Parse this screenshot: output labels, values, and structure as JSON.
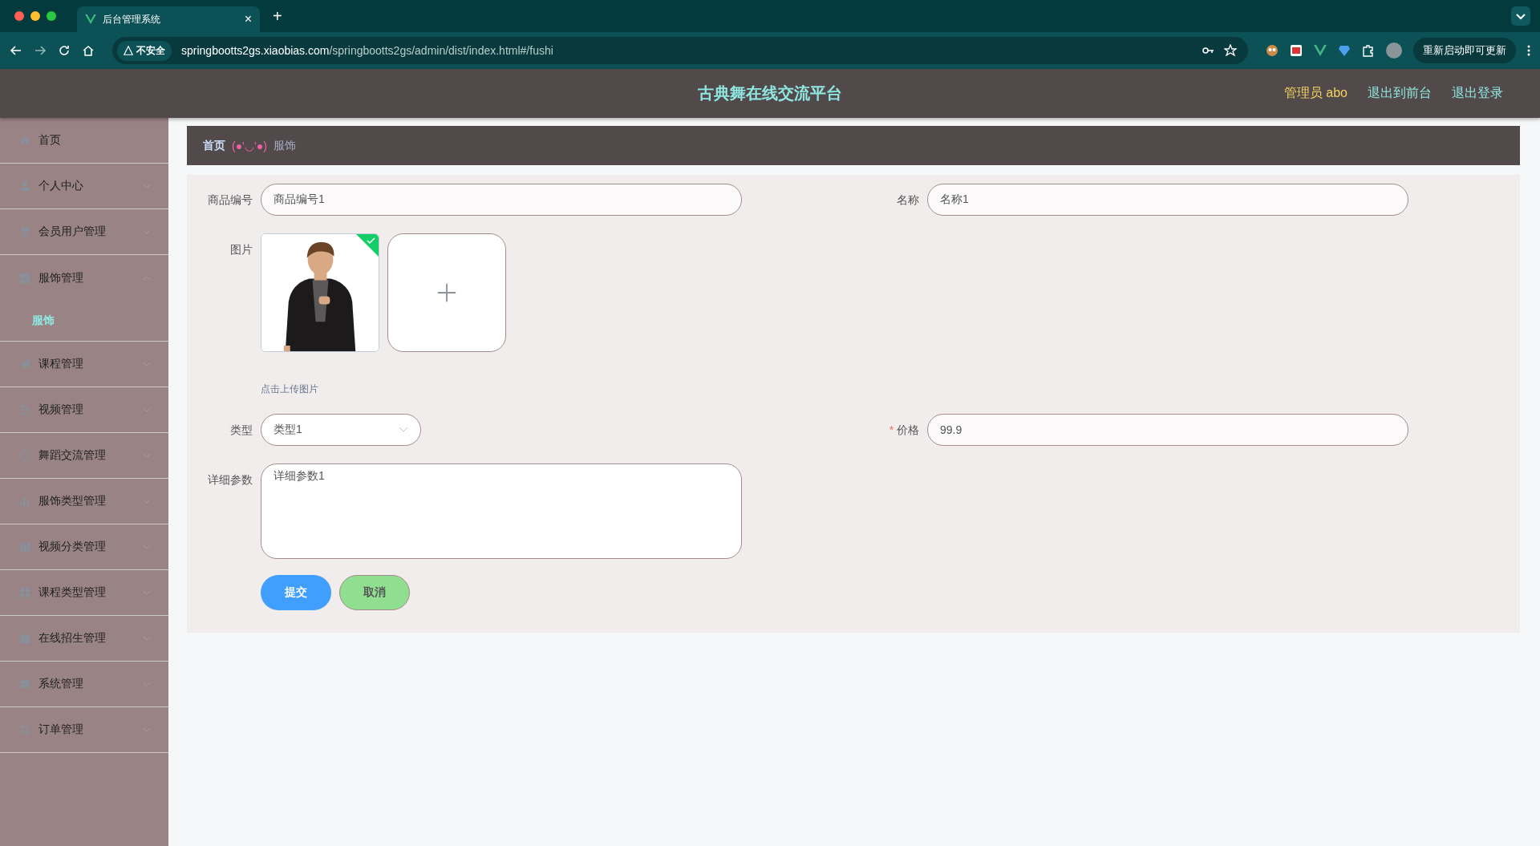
{
  "browser": {
    "tab_title": "后台管理系统",
    "tab_close": "×",
    "new_tab": "+",
    "security": "不安全",
    "url_host": "springbootts2gs.xiaobias.com",
    "url_path": "/springbootts2gs/admin/dist/index.html#/fushi",
    "update_button": "重新启动即可更新"
  },
  "header": {
    "title": "古典舞在线交流平台",
    "user": "管理员 abo",
    "links": [
      "退出到前台",
      "退出登录"
    ]
  },
  "sidebar": {
    "items": [
      {
        "kind": "link",
        "label": "首页",
        "selected": false
      },
      {
        "kind": "submenu",
        "label": "个人中心",
        "selected": false,
        "expanded": false
      },
      {
        "kind": "submenu",
        "label": "会员用户管理",
        "selected": false,
        "expanded": false
      },
      {
        "kind": "submenu",
        "label": "服饰管理",
        "selected": false,
        "expanded": true,
        "children": [
          {
            "label": "服饰",
            "selected": true
          }
        ]
      },
      {
        "kind": "submenu",
        "label": "课程管理",
        "selected": false,
        "expanded": false
      },
      {
        "kind": "submenu",
        "label": "视频管理",
        "selected": false,
        "expanded": false
      },
      {
        "kind": "submenu",
        "label": "舞蹈交流管理",
        "selected": false,
        "expanded": false
      },
      {
        "kind": "submenu",
        "label": "服饰类型管理",
        "selected": false,
        "expanded": false
      },
      {
        "kind": "submenu",
        "label": "视频分类管理",
        "selected": false,
        "expanded": false
      },
      {
        "kind": "submenu",
        "label": "课程类型管理",
        "selected": false,
        "expanded": false
      },
      {
        "kind": "submenu",
        "label": "在线招生管理",
        "selected": false,
        "expanded": false
      },
      {
        "kind": "submenu",
        "label": "系统管理",
        "selected": false,
        "expanded": false
      },
      {
        "kind": "submenu",
        "label": "订单管理",
        "selected": false,
        "expanded": false
      }
    ]
  },
  "breadcrumb": {
    "home": "首页",
    "separator": "(●'◡'●)",
    "current": "服饰"
  },
  "form": {
    "rows": [
      [
        {
          "kind": "text",
          "label": "商品编号",
          "value": "商品编号1"
        },
        {
          "kind": "text",
          "label": "名称",
          "value": "名称1"
        }
      ],
      [
        {
          "label": "图片",
          "images": [
            {
              "kind": "picture",
              "uploaded": true
            }
          ],
          "hint": "点击上传图片"
        }
      ],
      [
        {
          "kind": "select",
          "label": "类型",
          "value": "类型1"
        },
        {
          "kind": "text",
          "label": "价格",
          "required_mark": "*",
          "value": "99.9"
        }
      ],
      [
        {
          "kind": "textarea",
          "label": "详细参数",
          "value": "详细参数1"
        }
      ]
    ],
    "buttons": [
      {
        "kind": "primary",
        "label": "提交"
      },
      {
        "kind": "success",
        "label": "取消"
      }
    ]
  }
}
